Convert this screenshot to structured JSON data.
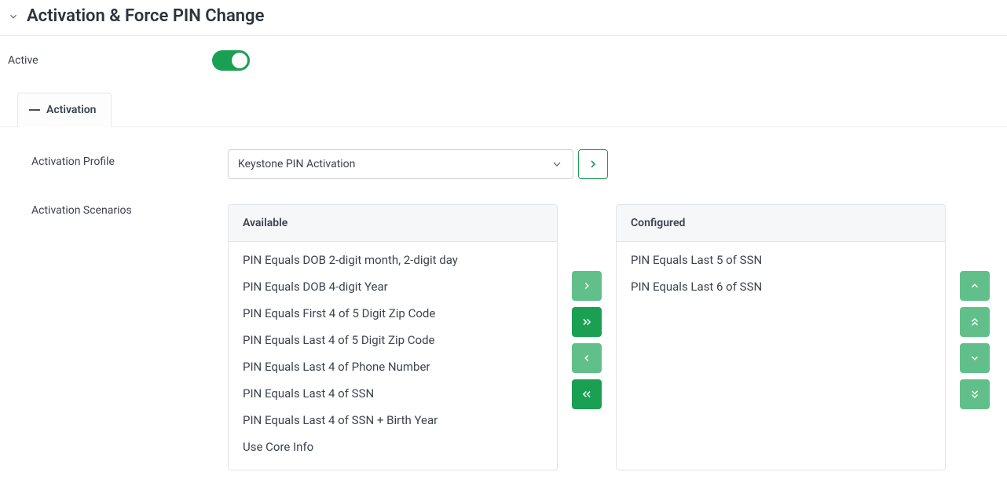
{
  "header": {
    "title": "Activation & Force PIN Change"
  },
  "active_row": {
    "label": "Active"
  },
  "tab": {
    "label": "Activation"
  },
  "profile": {
    "label": "Activation Profile",
    "selected": "Keystone PIN Activation"
  },
  "scenarios": {
    "label": "Activation Scenarios",
    "available_header": "Available",
    "configured_header": "Configured",
    "available": [
      "PIN Equals DOB 2-digit month, 2-digit day",
      "PIN Equals DOB 4-digit Year",
      "PIN Equals First 4 of 5 Digit Zip Code",
      "PIN Equals Last 4 of 5 Digit Zip Code",
      "PIN Equals Last 4 of Phone Number",
      "PIN Equals Last 4 of SSN",
      "PIN Equals Last 4 of SSN + Birth Year",
      "Use Core Info"
    ],
    "configured": [
      "PIN Equals Last 5 of SSN",
      "PIN Equals Last 6 of SSN"
    ]
  },
  "colors": {
    "accent": "#1aa053",
    "accent_disabled": "#61c08a"
  }
}
